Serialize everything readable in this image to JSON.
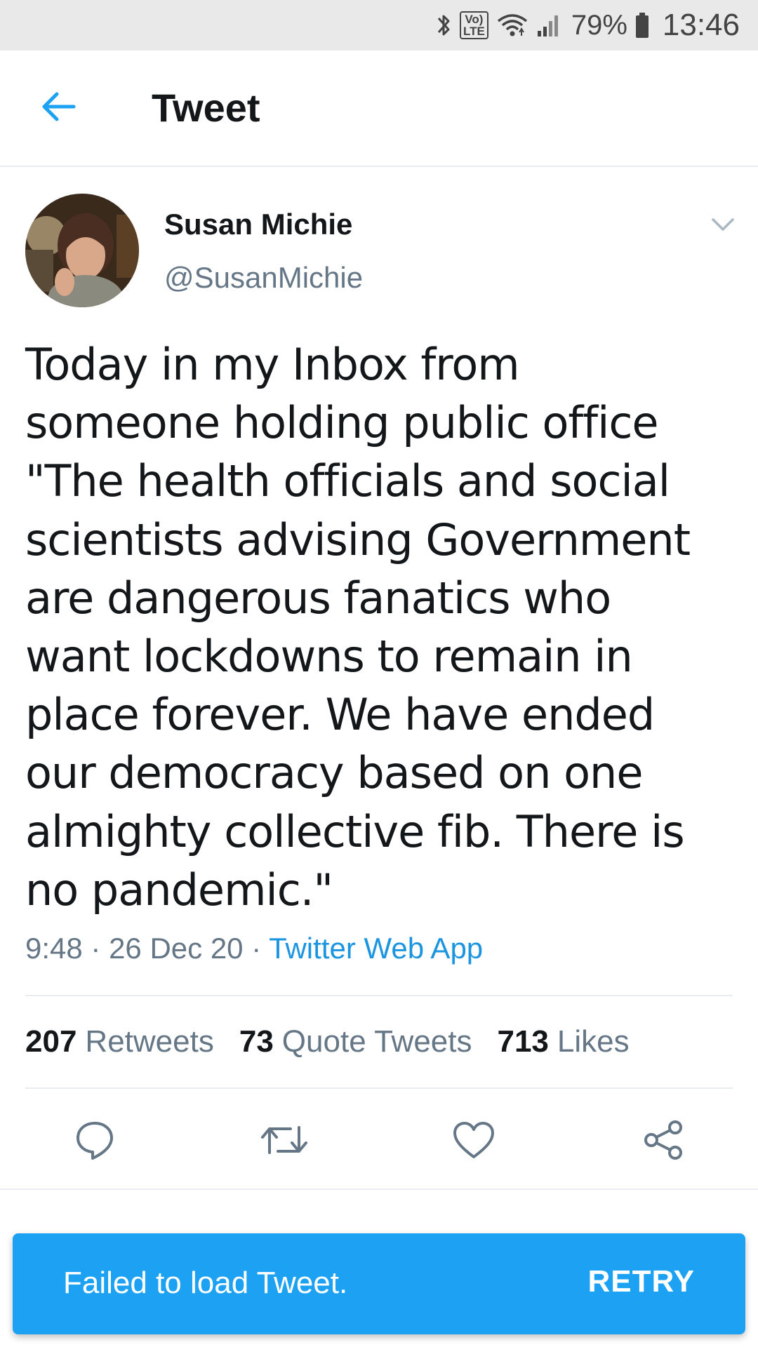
{
  "status_bar": {
    "network_label": "Vo)\nLTE",
    "battery_percent": "79%",
    "time": "13:46"
  },
  "header": {
    "title": "Tweet"
  },
  "tweet": {
    "author_name": "Susan Michie",
    "author_handle": "@SusanMichie",
    "text": "Today in my Inbox from\nsomeone holding public office\n\"The health officials and social\nscientists advising Government\nare dangerous fanatics who\nwant lockdowns to remain in\nplace forever. We have ended\nour democracy based on one\nalmighty collective fib. There is\nno pandemic.\"",
    "time": "9:48",
    "date": "26 Dec 20",
    "separator": " · ",
    "source": "Twitter Web App"
  },
  "stats": {
    "retweets_count": "207",
    "retweets_label": "Retweets",
    "quotes_count": "73",
    "quotes_label": "Quote Tweets",
    "likes_count": "713",
    "likes_label": "Likes"
  },
  "actions": {
    "icons": [
      "reply-icon",
      "retweet-icon",
      "like-icon",
      "share-icon"
    ]
  },
  "snackbar": {
    "message": "Failed to load Tweet.",
    "action_label": "RETRY"
  },
  "colors": {
    "accent": "#1da1f2",
    "link": "#1b95e0",
    "secondary_text": "#657786",
    "primary_text": "#14171a"
  }
}
